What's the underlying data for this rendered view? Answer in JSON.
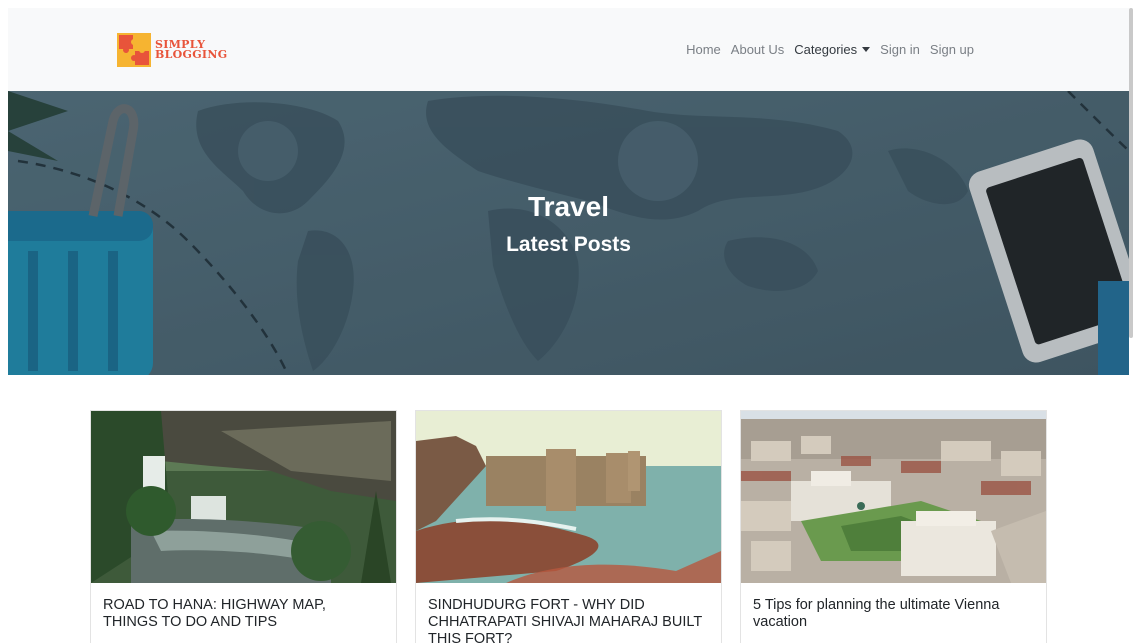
{
  "brand": {
    "line1": "SIMPLY",
    "line2": "BLOGGING"
  },
  "nav": {
    "items": [
      {
        "label": "Home"
      },
      {
        "label": "About Us"
      },
      {
        "label": "Categories"
      },
      {
        "label": "Sign in"
      },
      {
        "label": "Sign up"
      }
    ]
  },
  "hero": {
    "title": "Travel",
    "subtitle": "Latest Posts"
  },
  "posts": [
    {
      "title": "ROAD TO HANA: HIGHWAY MAP, THINGS TO DO AND TIPS"
    },
    {
      "title": "SINDHUDURG FORT - WHY DID CHHATRAPATI SHIVAJI MAHARAJ BUILT THIS FORT?"
    },
    {
      "title": "5 Tips for planning the ultimate Vienna vacation"
    }
  ],
  "colors": {
    "navbar_bg": "#f8f9fa",
    "brand_orange": "#e8543a",
    "logo_yellow": "#f6b431",
    "hero_overlay": "#4d6673"
  }
}
